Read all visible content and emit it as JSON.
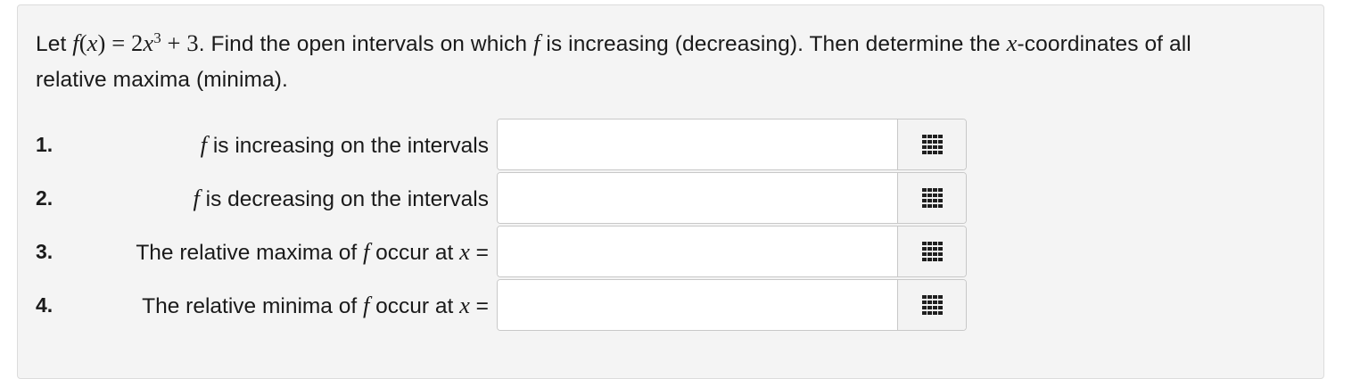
{
  "prompt": {
    "let": "Let ",
    "func_f": "f",
    "func_paren_open": "(",
    "func_x": "x",
    "func_paren_close": ")",
    "equals": " = 2",
    "x_var": "x",
    "exponent": "3",
    "plus_three": " + 3",
    "after_math": ". Find the open intervals on which ",
    "f_mid": "f",
    "after_f": " is increasing (decreasing). Then determine the ",
    "x_coord": "x",
    "tail": "-coordinates of all relative maxima (minima)."
  },
  "questions": [
    {
      "number": "1.",
      "label_pre": "",
      "label_f": "f",
      "label_post": " is increasing on the intervals",
      "label_x": "",
      "label_eq": "",
      "answer_value": "",
      "icon": "grid-keypad-icon"
    },
    {
      "number": "2.",
      "label_pre": "",
      "label_f": "f",
      "label_post": " is decreasing on the intervals",
      "label_x": "",
      "label_eq": "",
      "answer_value": "",
      "icon": "grid-keypad-icon"
    },
    {
      "number": "3.",
      "label_pre": "The relative maxima of ",
      "label_f": "f",
      "label_post": " occur at ",
      "label_x": "x",
      "label_eq": " =",
      "answer_value": "",
      "icon": "grid-keypad-icon"
    },
    {
      "number": "4.",
      "label_pre": "The relative minima of ",
      "label_f": "f",
      "label_post": " occur at ",
      "label_x": "x",
      "label_eq": " =",
      "answer_value": "",
      "icon": "grid-keypad-icon"
    }
  ],
  "colors": {
    "panel_bg": "#f4f4f4",
    "panel_border": "#dcdcdc",
    "input_border": "#c8c8c8",
    "button_bg": "#f3f3f3",
    "icon": "#1f1f1f"
  }
}
